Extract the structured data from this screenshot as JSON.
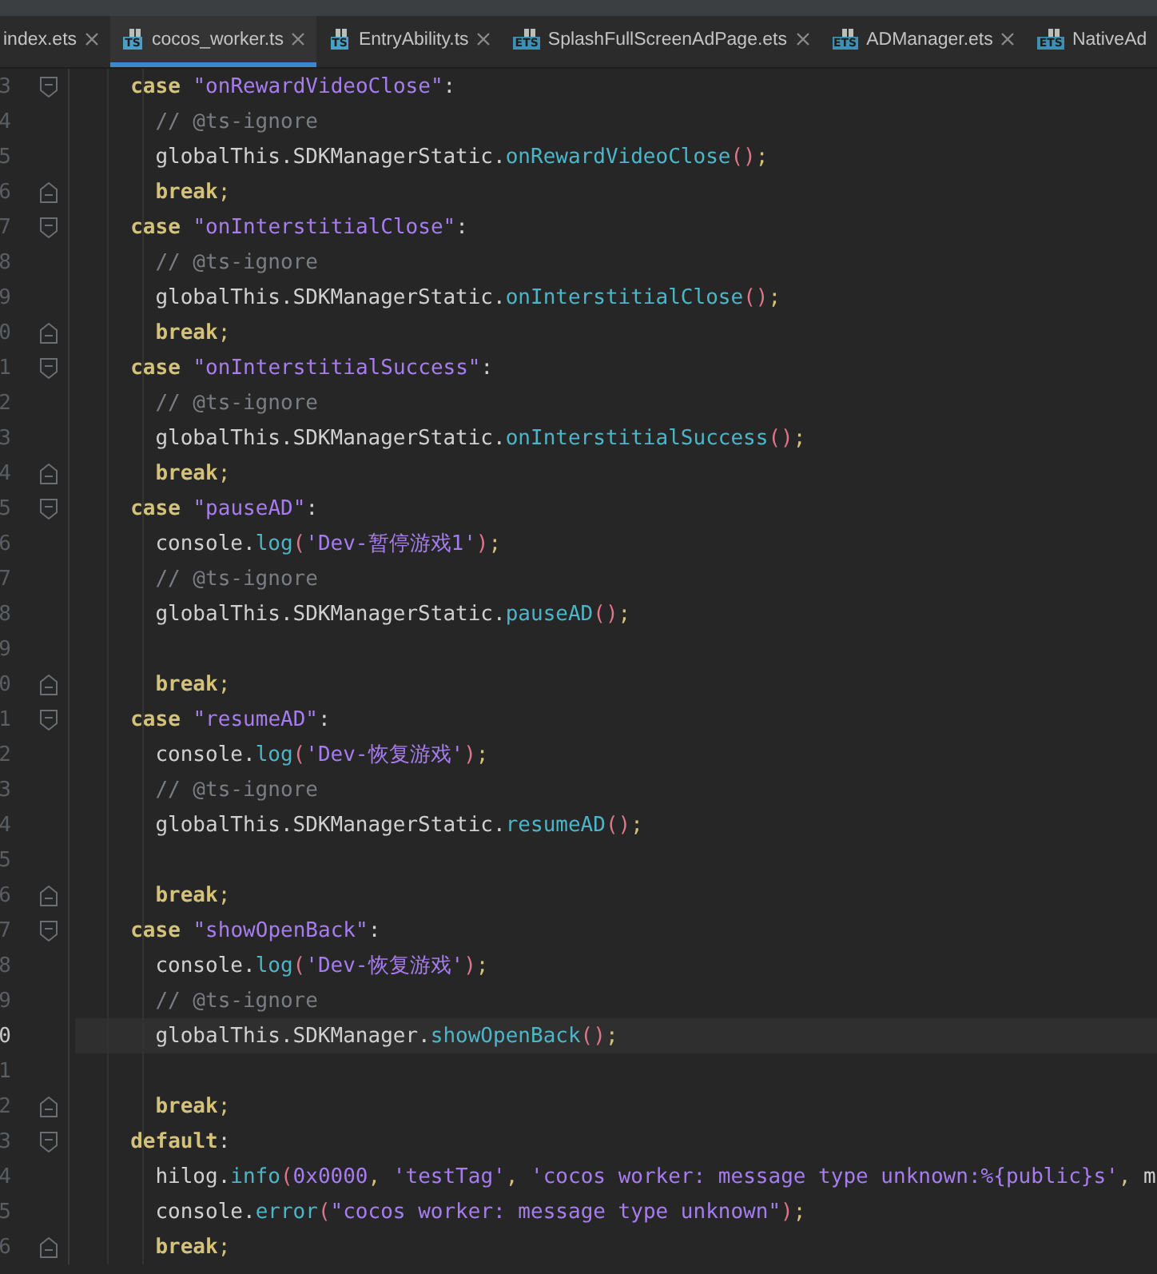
{
  "tabs": [
    {
      "label": "index.ets",
      "selected": false
    },
    {
      "label": "cocos_worker.ts",
      "icon": "TS",
      "selected": true
    },
    {
      "label": "EntryAbility.ts",
      "icon": "TS",
      "selected": false
    },
    {
      "label": "SplashFullScreenAdPage.ets",
      "icon": "ETS",
      "selected": false
    },
    {
      "label": "ADManager.ets",
      "icon": "ETS",
      "selected": false
    },
    {
      "label": "NativeAd",
      "icon": "ETS",
      "selected": false
    }
  ],
  "lines": [
    {
      "number": "3",
      "kind": "label",
      "fold_start": true,
      "fold_end": false,
      "current": false,
      "tokens": [
        {
          "kind": "kw",
          "text": "case"
        },
        {
          "kind": "str",
          "text": " \"onRewardVideoClose\""
        },
        {
          "kind": "plain",
          "text": ":"
        }
      ]
    },
    {
      "number": "4",
      "kind": "statement",
      "fold_start": false,
      "fold_end": false,
      "current": false,
      "tokens": [
        {
          "kind": "com",
          "text": "// @ts-ignore"
        }
      ]
    },
    {
      "number": "5",
      "kind": "statement",
      "fold_start": false,
      "fold_end": false,
      "current": false,
      "tokens": [
        {
          "kind": "plain",
          "text": "globalThis.SDKManagerStatic."
        },
        {
          "kind": "fn",
          "text": "onRewardVideoClose"
        },
        {
          "kind": "paren",
          "text": "()"
        },
        {
          "kind": "punct",
          "text": ";"
        }
      ]
    },
    {
      "number": "6",
      "kind": "statement",
      "fold_start": false,
      "fold_end": true,
      "current": false,
      "tokens": [
        {
          "kind": "kw",
          "text": "break"
        },
        {
          "kind": "punct",
          "text": ";"
        }
      ]
    },
    {
      "number": "7",
      "kind": "label",
      "fold_start": true,
      "fold_end": false,
      "current": false,
      "tokens": [
        {
          "kind": "kw",
          "text": "case"
        },
        {
          "kind": "str",
          "text": " \"onInterstitialClose\""
        },
        {
          "kind": "plain",
          "text": ":"
        }
      ]
    },
    {
      "number": "8",
      "kind": "statement",
      "fold_start": false,
      "fold_end": false,
      "current": false,
      "tokens": [
        {
          "kind": "com",
          "text": "// @ts-ignore"
        }
      ]
    },
    {
      "number": "9",
      "kind": "statement",
      "fold_start": false,
      "fold_end": false,
      "current": false,
      "tokens": [
        {
          "kind": "plain",
          "text": "globalThis.SDKManagerStatic."
        },
        {
          "kind": "fn",
          "text": "onInterstitialClose"
        },
        {
          "kind": "paren",
          "text": "()"
        },
        {
          "kind": "punct",
          "text": ";"
        }
      ]
    },
    {
      "number": "0",
      "kind": "statement",
      "fold_start": false,
      "fold_end": true,
      "current": false,
      "tokens": [
        {
          "kind": "kw",
          "text": "break"
        },
        {
          "kind": "punct",
          "text": ";"
        }
      ]
    },
    {
      "number": "1",
      "kind": "label",
      "fold_start": true,
      "fold_end": false,
      "current": false,
      "tokens": [
        {
          "kind": "kw",
          "text": "case"
        },
        {
          "kind": "str",
          "text": " \"onInterstitialSuccess\""
        },
        {
          "kind": "plain",
          "text": ":"
        }
      ]
    },
    {
      "number": "2",
      "kind": "statement",
      "fold_start": false,
      "fold_end": false,
      "current": false,
      "tokens": [
        {
          "kind": "com",
          "text": "// @ts-ignore"
        }
      ]
    },
    {
      "number": "3",
      "kind": "statement",
      "fold_start": false,
      "fold_end": false,
      "current": false,
      "tokens": [
        {
          "kind": "plain",
          "text": "globalThis.SDKManagerStatic."
        },
        {
          "kind": "fn",
          "text": "onInterstitialSuccess"
        },
        {
          "kind": "paren",
          "text": "()"
        },
        {
          "kind": "punct",
          "text": ";"
        }
      ]
    },
    {
      "number": "4",
      "kind": "statement",
      "fold_start": false,
      "fold_end": true,
      "current": false,
      "tokens": [
        {
          "kind": "kw",
          "text": "break"
        },
        {
          "kind": "punct",
          "text": ";"
        }
      ]
    },
    {
      "number": "5",
      "kind": "label",
      "fold_start": true,
      "fold_end": false,
      "current": false,
      "tokens": [
        {
          "kind": "kw",
          "text": "case"
        },
        {
          "kind": "str",
          "text": " \"pauseAD\""
        },
        {
          "kind": "plain",
          "text": ":"
        }
      ]
    },
    {
      "number": "6",
      "kind": "statement",
      "fold_start": false,
      "fold_end": false,
      "current": false,
      "tokens": [
        {
          "kind": "plain",
          "text": "console."
        },
        {
          "kind": "fn",
          "text": "log"
        },
        {
          "kind": "paren",
          "text": "("
        },
        {
          "kind": "str",
          "text": "'Dev-暂停游戏1'"
        },
        {
          "kind": "paren",
          "text": ")"
        },
        {
          "kind": "punct",
          "text": ";"
        }
      ]
    },
    {
      "number": "7",
      "kind": "statement",
      "fold_start": false,
      "fold_end": false,
      "current": false,
      "tokens": [
        {
          "kind": "com",
          "text": "// @ts-ignore"
        }
      ]
    },
    {
      "number": "8",
      "kind": "statement",
      "fold_start": false,
      "fold_end": false,
      "current": false,
      "tokens": [
        {
          "kind": "plain",
          "text": "globalThis.SDKManagerStatic."
        },
        {
          "kind": "fn",
          "text": "pauseAD"
        },
        {
          "kind": "paren",
          "text": "()"
        },
        {
          "kind": "punct",
          "text": ";"
        }
      ]
    },
    {
      "number": "9",
      "fold_start": false,
      "fold_end": false,
      "current": false
    },
    {
      "number": "0",
      "kind": "statement",
      "fold_start": false,
      "fold_end": true,
      "current": false,
      "tokens": [
        {
          "kind": "kw",
          "text": "break"
        },
        {
          "kind": "punct",
          "text": ";"
        }
      ]
    },
    {
      "number": "1",
      "kind": "label",
      "fold_start": true,
      "fold_end": false,
      "current": false,
      "tokens": [
        {
          "kind": "kw",
          "text": "case"
        },
        {
          "kind": "str",
          "text": " \"resumeAD\""
        },
        {
          "kind": "plain",
          "text": ":"
        }
      ]
    },
    {
      "number": "2",
      "kind": "statement",
      "fold_start": false,
      "fold_end": false,
      "current": false,
      "tokens": [
        {
          "kind": "plain",
          "text": "console."
        },
        {
          "kind": "fn",
          "text": "log"
        },
        {
          "kind": "paren",
          "text": "("
        },
        {
          "kind": "str",
          "text": "'Dev-恢复游戏'"
        },
        {
          "kind": "paren",
          "text": ")"
        },
        {
          "kind": "punct",
          "text": ";"
        }
      ]
    },
    {
      "number": "3",
      "kind": "statement",
      "fold_start": false,
      "fold_end": false,
      "current": false,
      "tokens": [
        {
          "kind": "com",
          "text": "// @ts-ignore"
        }
      ]
    },
    {
      "number": "4",
      "kind": "statement",
      "fold_start": false,
      "fold_end": false,
      "current": false,
      "tokens": [
        {
          "kind": "plain",
          "text": "globalThis.SDKManagerStatic."
        },
        {
          "kind": "fn",
          "text": "resumeAD"
        },
        {
          "kind": "paren",
          "text": "()"
        },
        {
          "kind": "punct",
          "text": ";"
        }
      ]
    },
    {
      "number": "5",
      "fold_start": false,
      "fold_end": false,
      "current": false
    },
    {
      "number": "6",
      "kind": "statement",
      "fold_start": false,
      "fold_end": true,
      "current": false,
      "tokens": [
        {
          "kind": "kw",
          "text": "break"
        },
        {
          "kind": "punct",
          "text": ";"
        }
      ]
    },
    {
      "number": "7",
      "kind": "label",
      "fold_start": true,
      "fold_end": false,
      "current": false,
      "tokens": [
        {
          "kind": "kw",
          "text": "case"
        },
        {
          "kind": "str",
          "text": " \"showOpenBack\""
        },
        {
          "kind": "plain",
          "text": ":"
        }
      ]
    },
    {
      "number": "8",
      "kind": "statement",
      "fold_start": false,
      "fold_end": false,
      "current": false,
      "tokens": [
        {
          "kind": "plain",
          "text": "console."
        },
        {
          "kind": "fn",
          "text": "log"
        },
        {
          "kind": "paren",
          "text": "("
        },
        {
          "kind": "str",
          "text": "'Dev-恢复游戏'"
        },
        {
          "kind": "paren",
          "text": ")"
        },
        {
          "kind": "punct",
          "text": ";"
        }
      ]
    },
    {
      "number": "9",
      "kind": "statement",
      "fold_start": false,
      "fold_end": false,
      "current": false,
      "tokens": [
        {
          "kind": "com",
          "text": "// @ts-ignore"
        }
      ]
    },
    {
      "number": "0",
      "kind": "statement",
      "fold_start": false,
      "fold_end": false,
      "current": true,
      "tokens": [
        {
          "kind": "plain",
          "text": "globalThis.SDKManager."
        },
        {
          "kind": "fn",
          "text": "showOpenBack"
        },
        {
          "kind": "paren",
          "text": "()"
        },
        {
          "kind": "punct",
          "text": ";"
        }
      ]
    },
    {
      "number": "1",
      "fold_start": false,
      "fold_end": false,
      "current": false
    },
    {
      "number": "2",
      "kind": "statement",
      "fold_start": false,
      "fold_end": true,
      "current": false,
      "tokens": [
        {
          "kind": "kw",
          "text": "break"
        },
        {
          "kind": "punct",
          "text": ";"
        }
      ]
    },
    {
      "number": "3",
      "kind": "label",
      "fold_start": true,
      "fold_end": false,
      "current": false,
      "tokens": [
        {
          "kind": "kw",
          "text": "default"
        },
        {
          "kind": "plain",
          "text": ":"
        }
      ]
    },
    {
      "number": "4",
      "kind": "statement",
      "fold_start": false,
      "fold_end": false,
      "current": false,
      "tokens": [
        {
          "kind": "plain",
          "text": "hilog."
        },
        {
          "kind": "fn",
          "text": "info"
        },
        {
          "kind": "paren",
          "text": "("
        },
        {
          "kind": "str",
          "text": "0x0000"
        },
        {
          "kind": "punct",
          "text": ", "
        },
        {
          "kind": "str",
          "text": "'testTag'"
        },
        {
          "kind": "punct",
          "text": ", "
        },
        {
          "kind": "str",
          "text": "'cocos worker: message type unknown:%{public}s'"
        },
        {
          "kind": "punct",
          "text": ", "
        },
        {
          "kind": "plain",
          "text": "m"
        }
      ]
    },
    {
      "number": "5",
      "kind": "statement",
      "fold_start": false,
      "fold_end": false,
      "current": false,
      "tokens": [
        {
          "kind": "plain",
          "text": "console."
        },
        {
          "kind": "fn",
          "text": "error"
        },
        {
          "kind": "paren",
          "text": "("
        },
        {
          "kind": "str",
          "text": "\"cocos worker: message type unknown\""
        },
        {
          "kind": "paren",
          "text": ")"
        },
        {
          "kind": "punct",
          "text": ";"
        }
      ]
    },
    {
      "number": "6",
      "kind": "statement",
      "fold_start": false,
      "fold_end": true,
      "current": false,
      "tokens": [
        {
          "kind": "kw",
          "text": "break"
        },
        {
          "kind": "punct",
          "text": ";"
        }
      ]
    }
  ]
}
